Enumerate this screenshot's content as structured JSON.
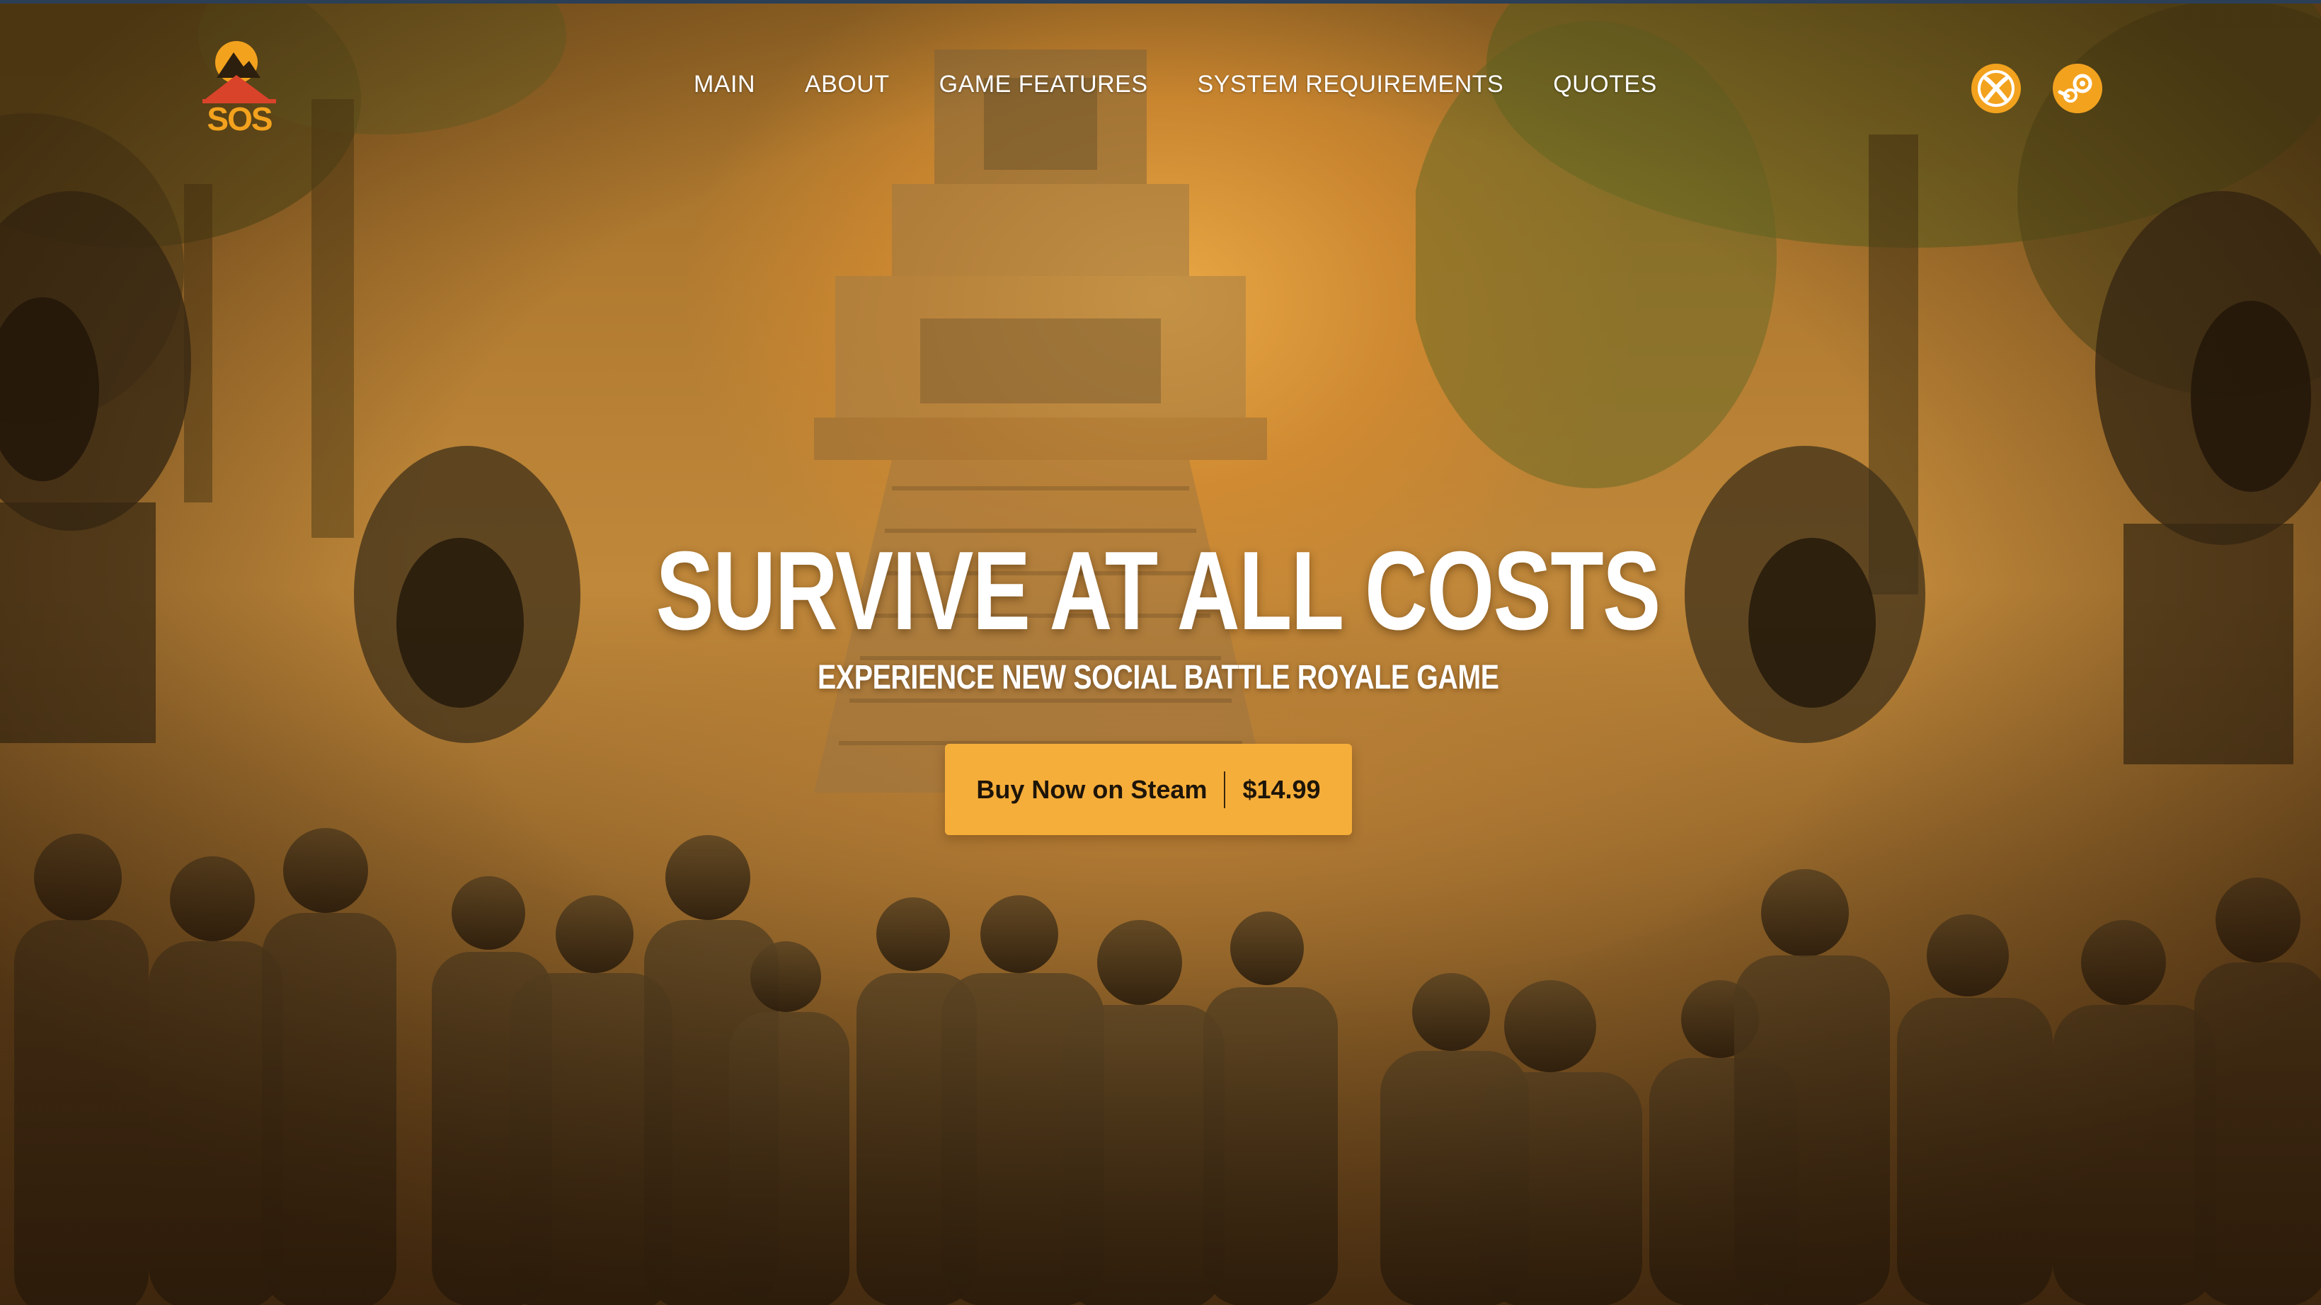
{
  "nav": {
    "logo_text": "SOS",
    "items": [
      {
        "label": "MAIN"
      },
      {
        "label": "ABOUT"
      },
      {
        "label": "GAME FEATURES"
      },
      {
        "label": "SYSTEM REQUIREMENTS"
      },
      {
        "label": "QUOTES"
      }
    ],
    "platforms": [
      {
        "icon": "xbox-icon"
      },
      {
        "icon": "steam-icon"
      }
    ]
  },
  "hero": {
    "title": "SURVIVE AT ALL COSTS",
    "subtitle": "EXPERIENCE NEW SOCIAL BATTLE ROYALE GAME",
    "buy_label": "Buy Now on Steam",
    "price": "$14.99"
  },
  "colors": {
    "accent": "#f6ae3a",
    "icon_accent": "#f3a21e",
    "logo_red": "#d9432a",
    "text": "#ffffff"
  }
}
